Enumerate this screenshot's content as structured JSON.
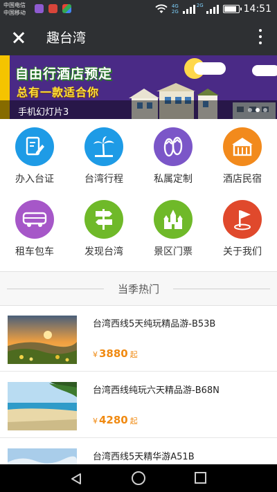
{
  "status_bar": {
    "carrier1": "中国电信",
    "carrier2": "中国移动",
    "net_top": "4G",
    "net_bottom": "2G",
    "net_right": "2G",
    "time": "14:51"
  },
  "title_bar": {
    "title": "趣台湾"
  },
  "banner": {
    "headline": "自由行酒店预定",
    "subline": "总有一款适合你",
    "caption": "手机幻灯片3",
    "slide_count": 3,
    "active_slide": 1
  },
  "menu": {
    "items": [
      {
        "label": "办入台证",
        "icon": "document-edit-icon",
        "color": "#1e9be6"
      },
      {
        "label": "台湾行程",
        "icon": "palm-tree-icon",
        "color": "#1e9be6"
      },
      {
        "label": "私属定制",
        "icon": "flip-flops-icon",
        "color": "#7b56c8"
      },
      {
        "label": "酒店民宿",
        "icon": "hotel-icon",
        "color": "#f28a1c"
      },
      {
        "label": "租车包车",
        "icon": "bus-icon",
        "color": "#a657c8"
      },
      {
        "label": "发现台湾",
        "icon": "signpost-icon",
        "color": "#6fb929"
      },
      {
        "label": "景区门票",
        "icon": "castle-icon",
        "color": "#6fb929"
      },
      {
        "label": "关于我们",
        "icon": "flag-pin-icon",
        "color": "#e0492c"
      }
    ]
  },
  "section": {
    "title": "当季热门"
  },
  "products": [
    {
      "title": "台湾西线5天纯玩精品游-B53B",
      "currency": "¥",
      "price": "3880",
      "suffix": "起"
    },
    {
      "title": "台湾西线纯玩六天精品游-B68N",
      "currency": "¥",
      "price": "4280",
      "suffix": "起"
    },
    {
      "title": "台湾西线5天精华游A51B",
      "currency": "",
      "price": "",
      "suffix": ""
    }
  ],
  "colors": {
    "header_bg": "#2e3033",
    "price": "#f08a12"
  }
}
